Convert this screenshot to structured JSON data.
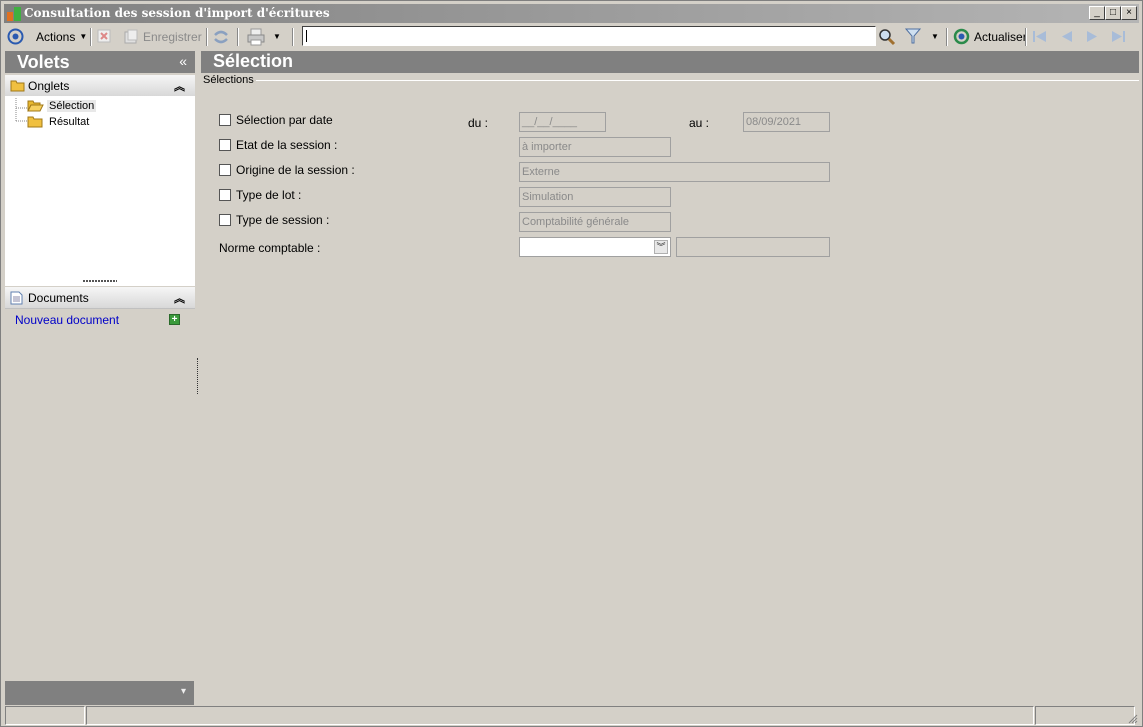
{
  "window": {
    "title": "Consultation des session d'import d'écritures",
    "min_glyph": "_",
    "max_glyph": "□",
    "close_glyph": "×"
  },
  "toolbar": {
    "actions_label": "Actions",
    "save_label": "Enregistrer",
    "search_value": "",
    "refresh_label": "Actualiser"
  },
  "sidebar": {
    "header": "Volets",
    "collapse_glyph": "«",
    "onglets": {
      "title": "Onglets",
      "toggle_glyph": "︽",
      "items": [
        {
          "label": "Sélection",
          "selected": true
        },
        {
          "label": "Résultat",
          "selected": false
        }
      ]
    },
    "documents": {
      "title": "Documents",
      "toggle_glyph": "︽",
      "new_document": "Nouveau document",
      "add_glyph": "+"
    },
    "bottom_glyph": "▾"
  },
  "main": {
    "header": "Sélection",
    "group_title": "Sélections",
    "date_row": {
      "label": "Sélection par date",
      "checked": false,
      "from_label": "du :",
      "from_value": "__/__/____",
      "to_label": "au :",
      "to_value": "08/09/2021"
    },
    "rows": [
      {
        "label": "Etat de la session :",
        "checked": false,
        "value": "à importer"
      },
      {
        "label": "Origine de la session :",
        "checked": false,
        "value": "Externe"
      },
      {
        "label": "Type de lot :",
        "checked": false,
        "value": "Simulation"
      },
      {
        "label": "Type de session :",
        "checked": false,
        "value": "Comptabilité générale"
      }
    ],
    "norme": {
      "label": "Norme comptable :",
      "value": "",
      "extra_value": "",
      "dropdown_glyph": "︾"
    }
  },
  "colors": {
    "background": "#d4d0c8",
    "header_bar": "#808080",
    "link": "#0000c8"
  }
}
